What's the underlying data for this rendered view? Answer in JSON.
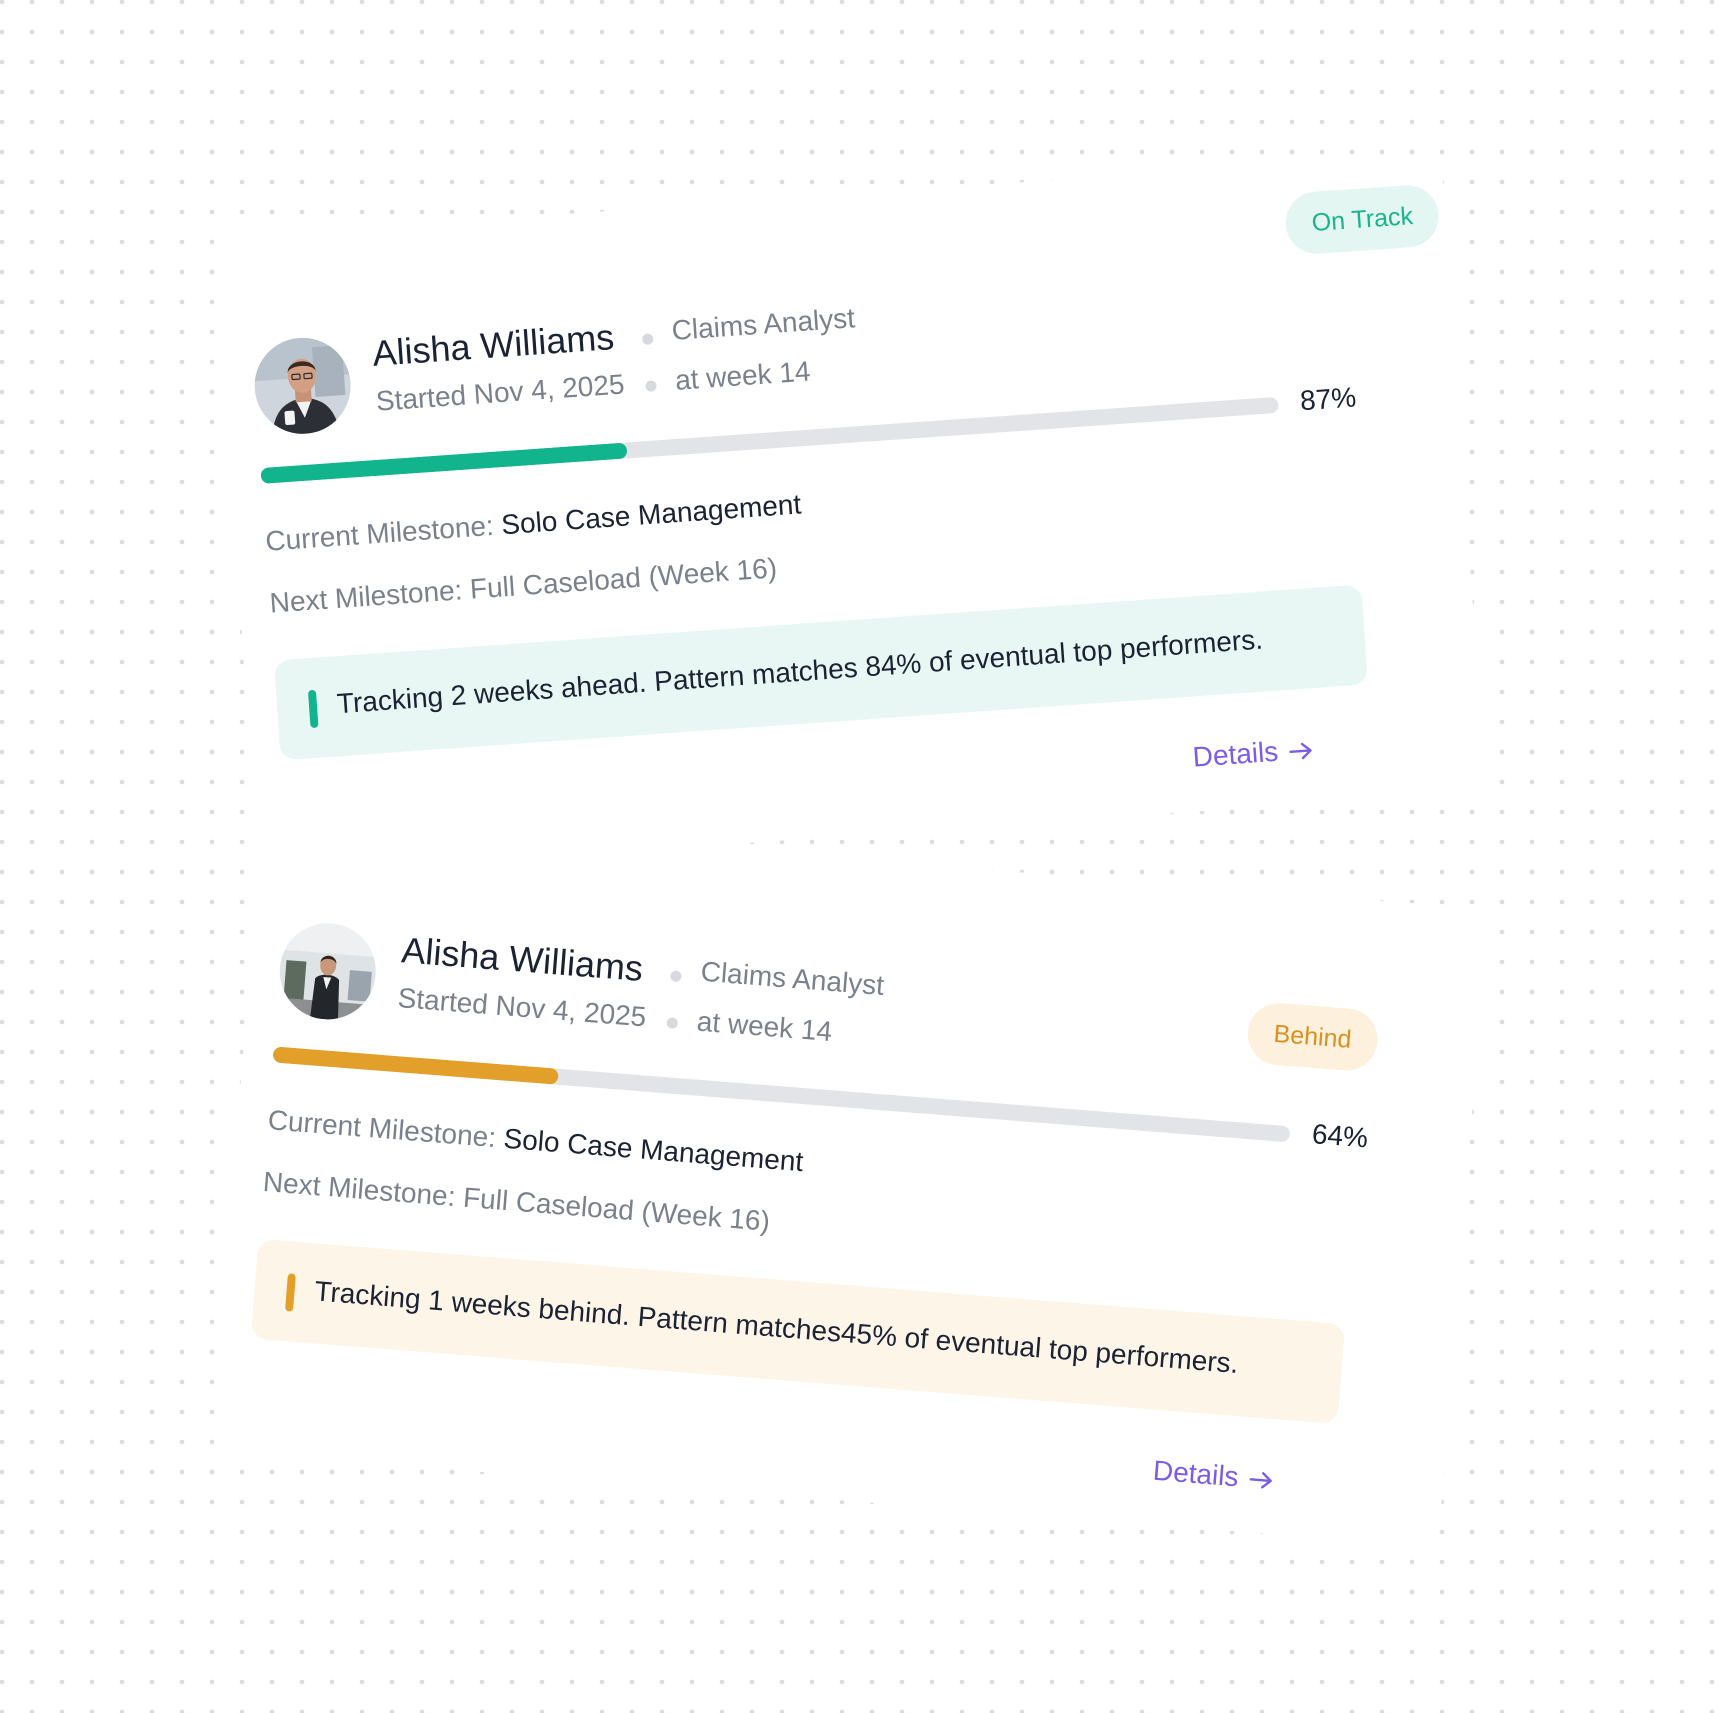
{
  "colors": {
    "on_track": "#12b48e",
    "behind": "#e2a02a",
    "link": "#7a5ce6",
    "text_primary": "#1a2233",
    "text_secondary": "#7b818c",
    "track": "#e3e4e7"
  },
  "cards": [
    {
      "name": "Alisha Williams",
      "role": "Claims Analyst",
      "started": "Started Nov 4, 2025",
      "week": "at week 14",
      "status": "On Track",
      "progress_label": "87%",
      "progress_fill_fraction": 0.36,
      "current_milestone_label": "Current Milestone: ",
      "current_milestone_value": "Solo Case Management",
      "next_milestone": "Next Milestone: Full Caseload (Week 16)",
      "insight": "Tracking 2 weeks ahead. Pattern matches 84% of eventual top performers.",
      "details_label": "Details",
      "avatar_icon": "person-photo-icon",
      "link_icon": "arrow-right-icon"
    },
    {
      "name": "Alisha Williams",
      "role": "Claims Analyst",
      "started": "Started Nov 4, 2025",
      "week": "at week 14",
      "status": "Behind",
      "progress_label": "64%",
      "progress_fill_fraction": 0.28,
      "current_milestone_label": "Current Milestone: ",
      "current_milestone_value": "Solo Case Management",
      "next_milestone": "Next Milestone: Full Caseload (Week 16)",
      "insight": "Tracking 1 weeks behind. Pattern matches45% of eventual top performers.",
      "details_label": "Details",
      "avatar_icon": "person-photo-icon",
      "link_icon": "arrow-right-icon"
    }
  ]
}
